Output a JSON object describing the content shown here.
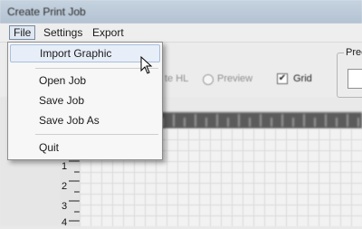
{
  "window": {
    "title": "Create Print Job"
  },
  "menubar": {
    "items": [
      {
        "label": "File",
        "active": true
      },
      {
        "label": "Settings",
        "active": false
      },
      {
        "label": "Export",
        "active": false
      }
    ]
  },
  "file_menu": {
    "items": [
      {
        "label": "Import Graphic",
        "highlighted": true
      },
      {
        "label": "Open Job"
      },
      {
        "label": "Save Job"
      },
      {
        "label": "Save Job As"
      },
      {
        "label": "Quit"
      }
    ]
  },
  "toolbar": {
    "partial_label": "te HL",
    "preview_label": "Preview",
    "grid_label": "Grid",
    "grid_checked": true,
    "group_label": "Prec"
  },
  "ruler": {
    "vertical_labels": [
      "1",
      "2",
      "3",
      "4"
    ]
  }
}
